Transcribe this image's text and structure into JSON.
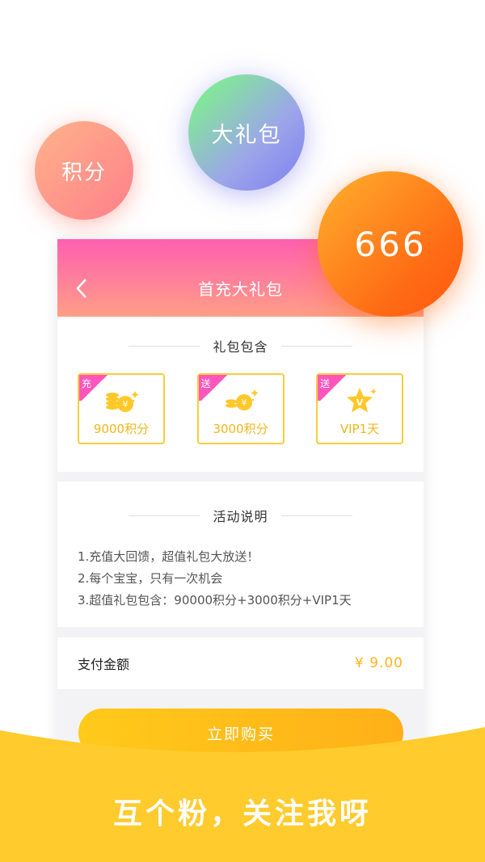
{
  "bubbles": {
    "points": "积分",
    "gift": "大礼包",
    "number": "666"
  },
  "header": {
    "title": "首充大礼包"
  },
  "package": {
    "title": "礼包包含",
    "items": [
      {
        "tag": "充",
        "label": "9000积分",
        "icon": "coins-icon"
      },
      {
        "tag": "送",
        "label": "3000积分",
        "icon": "coin-icon"
      },
      {
        "tag": "送",
        "label": "VIP1天",
        "icon": "vip-star-icon"
      }
    ]
  },
  "description": {
    "title": "活动说明",
    "lines": [
      "1.充值大回馈，超值礼包大放送！",
      "2.每个宝宝，只有一次机会",
      "3.超值礼包包含：90000积分+3000积分+VIP1天"
    ]
  },
  "payment": {
    "label": "支付金额",
    "amount": "¥ 9.00"
  },
  "buy_label": "立即购买",
  "slogan": "互个粉，关注我呀",
  "colors": {
    "accent_yellow": "#ffc929",
    "header_pink": "#ff5fb1",
    "tag_pink": "#ff56bd",
    "price": "#ffb41d"
  }
}
